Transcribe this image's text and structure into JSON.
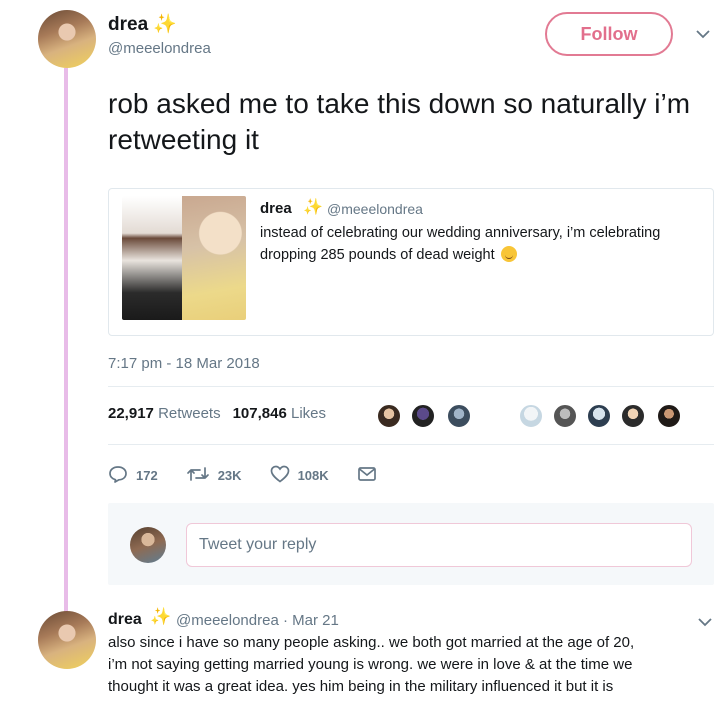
{
  "tweet": {
    "author_name": "drea",
    "author_handle": "@meeelondrea",
    "sparkle": "✨",
    "follow_label": "Follow",
    "text": "rob asked me to take this down so naturally i’m retweeting it",
    "timestamp": "7:17 pm - 18 Mar 2018",
    "retweets_count": "22,917",
    "retweets_label": "Retweets",
    "likes_count": "107,846",
    "likes_label": "Likes",
    "liker_avatar_count": 9
  },
  "quoted_tweet": {
    "author_name": "drea",
    "sparkle": "✨",
    "author_handle": "@meeelondrea",
    "text": "instead of celebrating our wedding anniversary, i’m celebrating dropping 285 pounds of dead weight",
    "emoji": "relieved-face"
  },
  "actions": {
    "reply_count": "172",
    "retweet_count": "23K",
    "like_count": "108K"
  },
  "reply_box": {
    "placeholder": "Tweet your reply"
  },
  "reply": {
    "author_name": "drea",
    "sparkle": "✨",
    "meta": "@meeelondrea · Mar 21",
    "text_lines": [
      "also since i have so many people asking.. we both got married at the age of 20,",
      "i’m not saying getting married young is wrong. we were in love & at the time we",
      "thought it was a great idea. yes him being in the military influenced it but it is"
    ]
  },
  "colors": {
    "follow_accent": "#e26f8c",
    "thread_line": "#e8bce8",
    "secondary_text": "#657786"
  }
}
